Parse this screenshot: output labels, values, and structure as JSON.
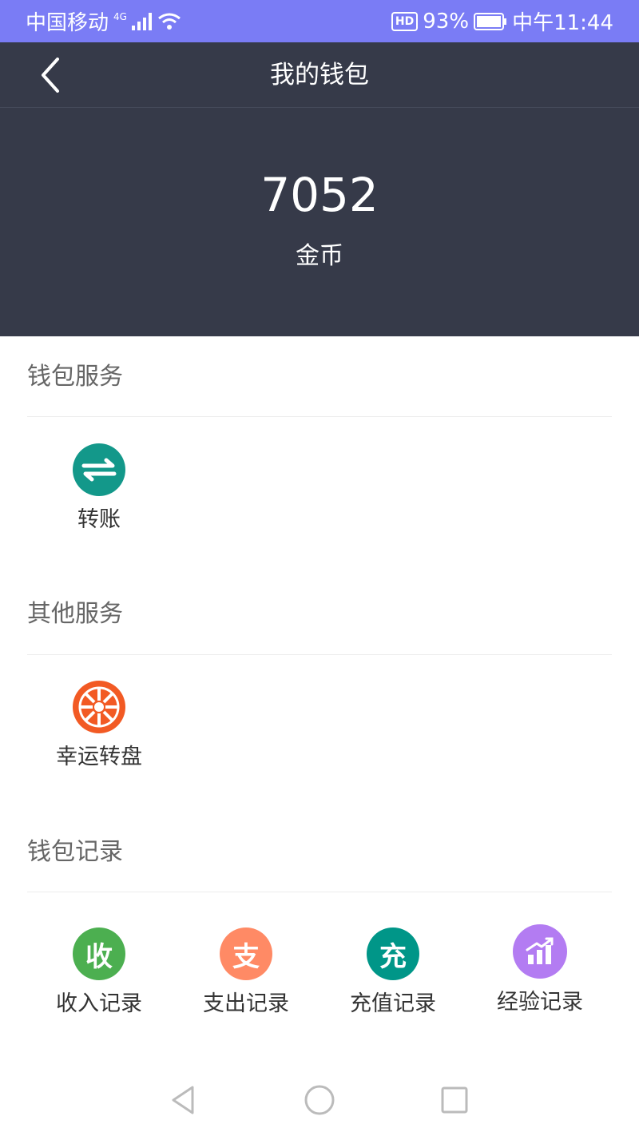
{
  "status_bar": {
    "carrier": "中国移动",
    "network": "4G",
    "battery": "93%",
    "time": "中午11:44",
    "hd_badge": "HD"
  },
  "header": {
    "title": "我的钱包"
  },
  "balance": {
    "value": "7052",
    "unit": "金币"
  },
  "sections": {
    "wallet_services": {
      "title": "钱包服务",
      "items": [
        {
          "label": "转账",
          "icon": "transfer-icon",
          "color": "#13988a"
        }
      ]
    },
    "other_services": {
      "title": "其他服务",
      "items": [
        {
          "label": "幸运转盘",
          "icon": "lucky-wheel-icon",
          "color": "#f25a24"
        }
      ]
    },
    "wallet_records": {
      "title": "钱包记录",
      "items": [
        {
          "label": "收入记录",
          "glyph": "收",
          "icon": "income-icon",
          "color": "#4caf50"
        },
        {
          "label": "支出记录",
          "glyph": "支",
          "icon": "expense-icon",
          "color": "#ff8a65"
        },
        {
          "label": "充值记录",
          "glyph": "充",
          "icon": "recharge-icon",
          "color": "#009688"
        },
        {
          "label": "经验记录",
          "icon": "experience-chart-icon",
          "color": "#b37cf2"
        }
      ]
    }
  }
}
